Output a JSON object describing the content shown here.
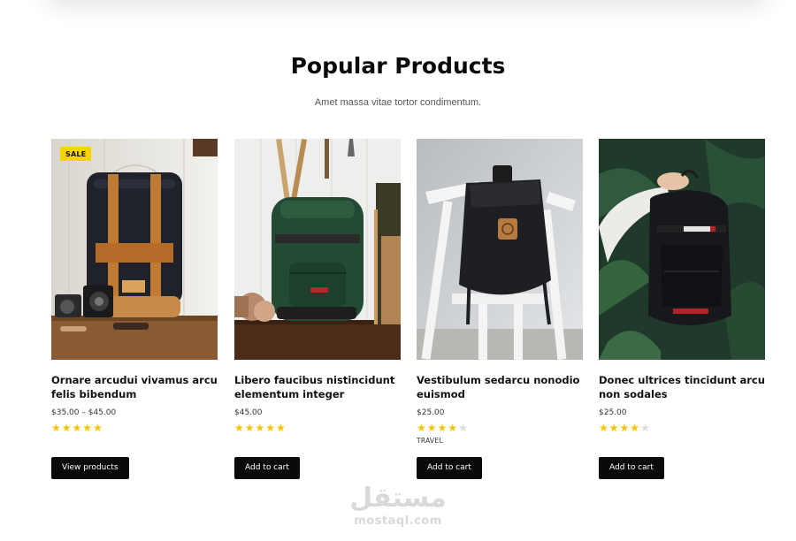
{
  "section": {
    "title": "Popular Products",
    "subtitle": "Amet massa vitae tortor condimentum."
  },
  "colors": {
    "accent_yellow": "#f4c300",
    "button_bg": "#0a0a0a",
    "star_empty": "#dcdcdc"
  },
  "products": [
    {
      "badge": "SALE",
      "title": "Ornare arcudui vivamus arcu felis bibendum",
      "price": "$35.00 – $45.00",
      "rating": 5,
      "category": "",
      "button": "View products",
      "image": "black-orange-backpack-on-table"
    },
    {
      "badge": "",
      "title": "Libero faucibus nistincidunt elementum integer",
      "price": "$45.00",
      "rating": 5,
      "category": "",
      "button": "Add to cart",
      "image": "green-backpack-wooden-floor"
    },
    {
      "badge": "",
      "title": "Vestibulum sedarcu nonodio euismod",
      "price": "$25.00",
      "rating": 4,
      "category": "TRAVEL",
      "button": "Add to cart",
      "image": "black-backpack-on-white-chair"
    },
    {
      "badge": "",
      "title": "Donec ultrices tincidunt arcu non sodales",
      "price": "$25.00",
      "rating": 4,
      "category": "",
      "button": "Add to cart",
      "image": "hand-holding-black-backpack"
    }
  ],
  "watermark": {
    "logo": "مستقل",
    "url": "mostaql.com"
  }
}
